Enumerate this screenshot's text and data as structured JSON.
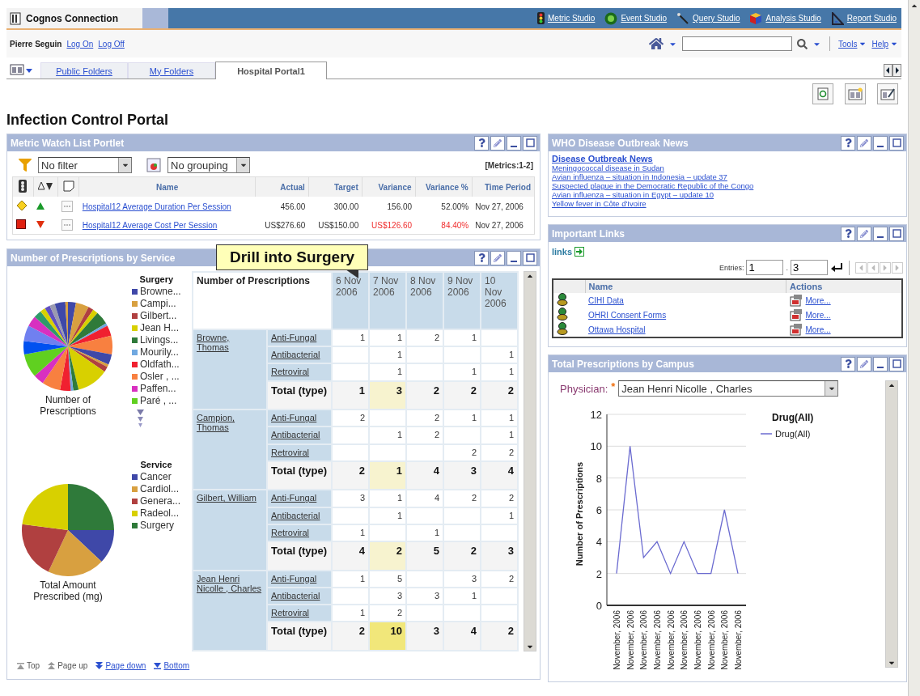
{
  "app_bar": {
    "title": "Cognos Connection",
    "studios": [
      {
        "label": "Metric Studio",
        "kind": "metric"
      },
      {
        "label": "Event Studio",
        "kind": "event"
      },
      {
        "label": "Query Studio",
        "kind": "query"
      },
      {
        "label": "Analysis Studio",
        "kind": "analysis"
      },
      {
        "label": "Report Studio",
        "kind": "report"
      }
    ]
  },
  "user_bar": {
    "user": "Pierre Seguin",
    "links": [
      "Log On",
      "Log Off"
    ],
    "menus": [
      "Tools",
      "Help"
    ]
  },
  "tabs": [
    {
      "label": "Public Folders",
      "selected": false
    },
    {
      "label": "My Folders",
      "selected": false
    },
    {
      "label": "Hospital Portal1",
      "selected": true
    }
  ],
  "page_title": "Infection Control Portal",
  "metric_portlet": {
    "title": "Metric Watch List Portlet",
    "filter": "No filter",
    "grouping": "No grouping",
    "count": "[Metrics:1-2]",
    "columns": [
      "Name",
      "Actual",
      "Target",
      "Variance",
      "Variance %",
      "Time Period"
    ],
    "rows": [
      {
        "critical": false,
        "trend_up": true,
        "name": "Hospital12 Average Duration Per Session",
        "actual": "456.00",
        "target": "300.00",
        "variance": "156.00",
        "variance_pct": "52.00%",
        "period": "Nov 27, 2006",
        "negative": false
      },
      {
        "critical": true,
        "trend_up": false,
        "name": "Hospital12 Average Cost Per Session",
        "actual": "US$276.60",
        "target": "US$150.00",
        "variance": "US$126.60",
        "variance_pct": "84.40%",
        "period": "Nov 27, 2006",
        "negative": true
      }
    ]
  },
  "prescriptions_portlet": {
    "title": "Number of Prescriptions by Service",
    "tooltip": "Drill into Surgery",
    "pies": [
      {
        "legend_title": "Surgery",
        "caption": "Number of Prescriptions",
        "more": true,
        "items": [
          {
            "label": "Browne...",
            "color": "#3f48a8"
          },
          {
            "label": "Campi...",
            "color": "#d8a040"
          },
          {
            "label": "Gilbert...",
            "color": "#b04040"
          },
          {
            "label": "Jean H...",
            "color": "#d8d000"
          },
          {
            "label": "Livings...",
            "color": "#2f7a3a"
          },
          {
            "label": "Mourily...",
            "color": "#70a8e0"
          },
          {
            "label": "Oldfath...",
            "color": "#f02030"
          },
          {
            "label": "Osler , ...",
            "color": "#f88040"
          },
          {
            "label": "Paffen...",
            "color": "#d830c0"
          },
          {
            "label": "Paré , ...",
            "color": "#60d020"
          }
        ]
      },
      {
        "legend_title": "Service",
        "caption": "Total Amount Prescribed (mg)",
        "more": false,
        "items": [
          {
            "label": "Cancer",
            "color": "#3f48a8"
          },
          {
            "label": "Cardiol...",
            "color": "#d8a040"
          },
          {
            "label": "Genera...",
            "color": "#b04040"
          },
          {
            "label": "Radeol...",
            "color": "#d8d000"
          },
          {
            "label": "Surgery",
            "color": "#2f7a3a"
          }
        ]
      }
    ],
    "crosstab": {
      "corner": "Number of Prescriptions",
      "columns": [
        "6 Nov 2006",
        "7 Nov 2006",
        "8 Nov 2006",
        "9 Nov 2006",
        "10 Nov 2006"
      ],
      "groups": [
        {
          "physician": "Browne, Thomas",
          "rows": [
            {
              "type": "Anti-Fungal",
              "values": {
                "col_1": "1",
                "col_2": "1",
                "col_3": "2",
                "col_4": "1"
              }
            },
            {
              "type": "Antibacterial",
              "values": {
                "col_2": "1",
                "col_5": "1"
              }
            },
            {
              "type": "Retroviral",
              "values": {
                "col_2": "1",
                "col_4": "1",
                "col_5": "1"
              }
            }
          ],
          "total_label": "Total (type)",
          "totals": [
            {
              "value": "1",
              "highlighted": false,
              "selected": false
            },
            {
              "value": "3",
              "highlighted": true,
              "selected": false
            },
            {
              "value": "2",
              "highlighted": false,
              "selected": false
            },
            {
              "value": "2",
              "highlighted": false,
              "selected": false
            },
            {
              "value": "2",
              "highlighted": false,
              "selected": false
            }
          ]
        },
        {
          "physician": "Campion, Thomas",
          "rows": [
            {
              "type": "Anti-Fungal",
              "values": {
                "col_1": "2",
                "col_3": "2",
                "col_4": "1",
                "col_5": "1"
              }
            },
            {
              "type": "Antibacterial",
              "values": {
                "col_2": "1",
                "col_3": "2",
                "col_5": "1"
              }
            },
            {
              "type": "Retroviral",
              "values": {
                "col_4": "2",
                "col_5": "2"
              }
            }
          ],
          "total_label": "Total (type)",
          "totals": [
            {
              "value": "2",
              "highlighted": false,
              "selected": false
            },
            {
              "value": "1",
              "highlighted": true,
              "selected": false
            },
            {
              "value": "4",
              "highlighted": false,
              "selected": false
            },
            {
              "value": "3",
              "highlighted": false,
              "selected": false
            },
            {
              "value": "4",
              "highlighted": false,
              "selected": false
            }
          ]
        },
        {
          "physician": "Gilbert, William",
          "rows": [
            {
              "type": "Anti-Fungal",
              "values": {
                "col_1": "3",
                "col_2": "1",
                "col_3": "4",
                "col_4": "2",
                "col_5": "2"
              }
            },
            {
              "type": "Antibacterial",
              "values": {
                "col_2": "1",
                "col_5": "1"
              }
            },
            {
              "type": "Retroviral",
              "values": {
                "col_1": "1",
                "col_3": "1"
              }
            }
          ],
          "total_label": "Total (type)",
          "totals": [
            {
              "value": "4",
              "highlighted": false,
              "selected": false
            },
            {
              "value": "2",
              "highlighted": true,
              "selected": false
            },
            {
              "value": "5",
              "highlighted": false,
              "selected": false
            },
            {
              "value": "2",
              "highlighted": false,
              "selected": false
            },
            {
              "value": "3",
              "highlighted": false,
              "selected": false
            }
          ]
        },
        {
          "physician": "Jean Henri Nicolle , Charles",
          "rows": [
            {
              "type": "Anti-Fungal",
              "values": {
                "col_1": "1",
                "col_2": "5",
                "col_4": "3",
                "col_5": "2"
              }
            },
            {
              "type": "Antibacterial",
              "values": {
                "col_2": "3",
                "col_3": "3",
                "col_4": "1"
              }
            },
            {
              "type": "Retroviral",
              "values": {
                "col_1": "1",
                "col_2": "2"
              }
            }
          ],
          "total_label": "Total (type)",
          "totals": [
            {
              "value": "2",
              "highlighted": false,
              "selected": false
            },
            {
              "value": "10",
              "highlighted": true,
              "selected": true
            },
            {
              "value": "3",
              "highlighted": false,
              "selected": false
            },
            {
              "value": "4",
              "highlighted": false,
              "selected": false
            },
            {
              "value": "2",
              "highlighted": false,
              "selected": false
            }
          ]
        }
      ]
    },
    "nav": [
      {
        "label": "Top",
        "kind": "top",
        "disabled": true
      },
      {
        "label": "Page up",
        "kind": "up",
        "disabled": true
      },
      {
        "label": "Page down",
        "kind": "down",
        "disabled": false
      },
      {
        "label": "Bottom",
        "kind": "bottom",
        "disabled": false
      }
    ]
  },
  "news_portlet": {
    "title": "WHO Disease Outbreak News",
    "heading": "Disease Outbreak News",
    "items": [
      "Meningococcal disease in Sudan",
      "Avian influenza – situation in Indonesia – update 37",
      "Suspected plague in the Democratic Republic of the Congo",
      "Avian influenza – situation in Egypt – update 10",
      "Yellow fever in Côte d'Ivoire"
    ]
  },
  "links_portlet": {
    "title": "Important Links",
    "label": "links",
    "entries_label": "Entries:",
    "from": "1",
    "separator": ".",
    "to": "3",
    "columns": [
      "Name",
      "Actions"
    ],
    "rows": [
      {
        "name": "CIHI Data",
        "action": "More..."
      },
      {
        "name": "OHRI Consent Forms",
        "action": "More..."
      },
      {
        "name": "Ottawa Hospital",
        "action": "More..."
      }
    ]
  },
  "campus_portlet": {
    "title": "Total Prescriptions by Campus",
    "physician_label": "Physician:",
    "required_mark": "*",
    "physician": "Jean Henri Nicolle , Charles",
    "legend_title": "Drug(All)",
    "chart_data": {
      "type": "line",
      "ylabel": "Number of Prescriptions",
      "grid": true,
      "categories": [
        "November, 2006",
        "November, 2006",
        "November, 2006",
        "November, 2006",
        "November, 2006",
        "November, 2006",
        "November, 2006",
        "November, 2006",
        "November, 2006",
        "November, 2006"
      ],
      "series": [
        {
          "name": "Drug(All)",
          "color": "#6b6bd0",
          "values": [
            2,
            10,
            3,
            4,
            2,
            4,
            2,
            2,
            6,
            2
          ]
        }
      ],
      "ylim": [
        0,
        12
      ],
      "yticks": [
        0,
        2,
        4,
        6,
        8,
        10,
        12
      ]
    }
  }
}
